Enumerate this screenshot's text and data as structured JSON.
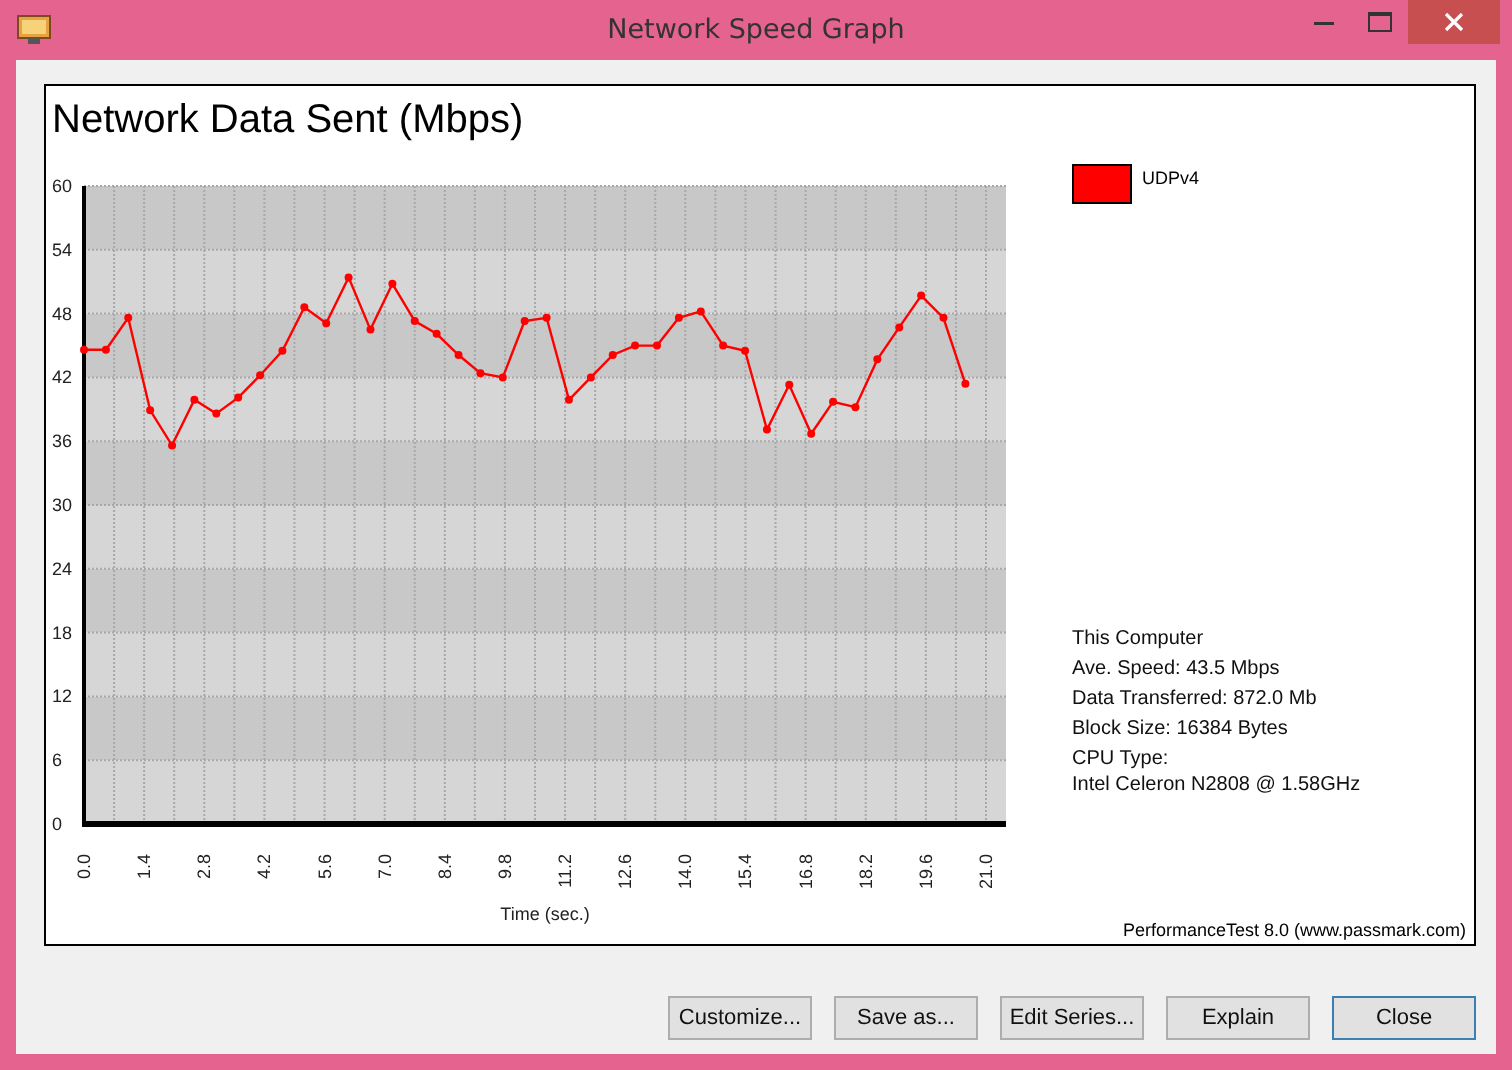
{
  "window": {
    "title": "Network Speed Graph"
  },
  "graph": {
    "chart_data": {
      "type": "line",
      "title": "Network Data Sent (Mbps)",
      "xlabel": "Time (sec.)",
      "xlim": [
        0,
        21
      ],
      "ylim": [
        0,
        60
      ],
      "xticks": [
        {
          "value": 0,
          "label": "0.0"
        },
        1.4,
        2.8,
        4.2,
        5.6,
        {
          "value": 7,
          "label": "7.0"
        },
        8.4,
        9.8,
        11.2,
        12.6,
        {
          "value": 14,
          "label": "14.0"
        },
        15.4,
        16.8,
        18.2,
        19.6,
        {
          "value": 21,
          "label": "21.0"
        }
      ],
      "yticks": [
        0,
        6,
        12,
        18,
        24,
        30,
        36,
        42,
        48,
        54,
        60
      ],
      "grid": true,
      "x": [
        0,
        0.51,
        1.03,
        1.54,
        2.05,
        2.57,
        3.08,
        3.59,
        4.1,
        4.62,
        5.13,
        5.64,
        6.16,
        6.67,
        7.18,
        7.7,
        8.21,
        8.72,
        9.23,
        9.75,
        10.26,
        10.77,
        11.29,
        11.8,
        12.31,
        12.83,
        13.34,
        13.85,
        14.36,
        14.88,
        15.39,
        15.9,
        16.42,
        16.93,
        17.44,
        17.96,
        18.47,
        18.98,
        19.49,
        20.01,
        20.52
      ],
      "series": [
        {
          "name": "UDPv4",
          "color": "#ff0000",
          "marker": "circle",
          "values": [
            44.6,
            44.6,
            47.6,
            38.9,
            35.6,
            39.9,
            38.6,
            40.1,
            42.2,
            44.5,
            48.6,
            47.1,
            51.4,
            46.5,
            50.8,
            47.3,
            46.1,
            44.1,
            42.4,
            42.0,
            47.3,
            47.6,
            39.9,
            42.0,
            44.1,
            45.0,
            45.0,
            47.6,
            48.2,
            45.0,
            44.5,
            37.1,
            41.3,
            36.7,
            39.7,
            39.2,
            43.7,
            46.7,
            49.7,
            47.6,
            41.4
          ]
        }
      ]
    },
    "stats": [
      "This Computer",
      "Ave. Speed: 43.5 Mbps",
      "Data Transferred: 872.0 Mb",
      "Block Size: 16384 Bytes",
      "CPU Type:",
      "Intel Celeron N2808 @ 1.58GHz"
    ],
    "credit": "PerformanceTest 8.0 (www.passmark.com)"
  },
  "buttons": [
    {
      "label": "Customize...",
      "default": false
    },
    {
      "label": "Save as...",
      "default": false
    },
    {
      "label": "Edit Series...",
      "default": false
    },
    {
      "label": "Explain",
      "default": false
    },
    {
      "label": "Close",
      "default": true
    }
  ]
}
